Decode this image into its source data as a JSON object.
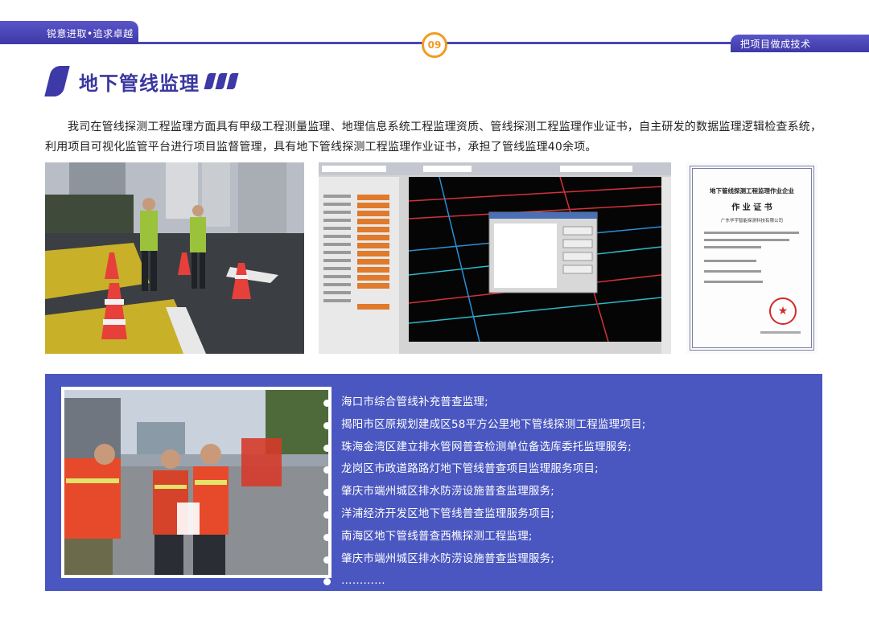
{
  "header": {
    "left_label": "锐意进取•追求卓越",
    "right_label": "把项目做成技术",
    "page_number": "09"
  },
  "section": {
    "title": "地下管线监理"
  },
  "intro": {
    "text": "我司在管线探测工程监理方面具有甲级工程测量监理、地理信息系统工程监理资质、管线探测工程监理作业证书，自主研发的数据监理逻辑检查系统，利用项目可视化监管平台进行项目监督管理，具有地下管线探测工程监理作业证书，承担了管线监理40余项。"
  },
  "certificate": {
    "heading": "地下管线探测工程监理作业企业",
    "subheading": "作 业 证 书",
    "company": "广东华宇智能探测科技有限公司"
  },
  "projects": {
    "items": [
      "海口市综合管线补充普查监理;",
      "揭阳市区原规划建成区58平方公里地下管线探测工程监理项目;",
      "珠海金湾区建立排水管网普查检测单位备选库委托监理服务;",
      "龙岗区市政道路路灯地下管线普查项目监理服务项目;",
      "肇庆市端州城区排水防涝设施普查监理服务;",
      "洋浦经济开发区地下管线普查监理服务项目;",
      "南海区地下管线普查西樵探测工程监理;",
      "肇庆市端州城区排水防涝设施普查监理服务;",
      "…………"
    ]
  },
  "colors": {
    "brand_purple": "#3d39a6",
    "panel_blue": "#4a57c0",
    "accent_orange": "#f29b22"
  }
}
